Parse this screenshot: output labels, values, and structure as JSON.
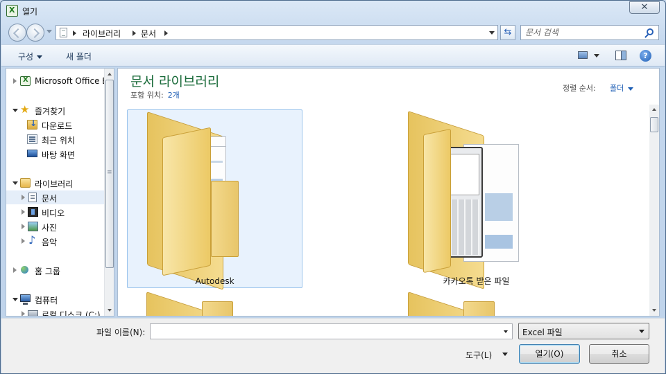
{
  "window": {
    "title": "열기",
    "close_glyph": "✕"
  },
  "address_bar": {
    "crumbs": [
      "라이브러리",
      "문서"
    ]
  },
  "search": {
    "placeholder": "문서 검색"
  },
  "toolbar": {
    "organize": "구성",
    "new_folder": "새 폴더",
    "help_glyph": "?"
  },
  "nav": {
    "items": [
      {
        "label": "Microsoft Office Excel",
        "icon": "excel-icon"
      },
      {
        "label": "즐겨찾기",
        "icon": "star-icon"
      },
      {
        "label": "다운로드",
        "icon": "downloads-folder-icon"
      },
      {
        "label": "최근 위치",
        "icon": "recent-places-icon"
      },
      {
        "label": "바탕 화면",
        "icon": "desktop-icon"
      },
      {
        "label": "라이브러리",
        "icon": "library-icon"
      },
      {
        "label": "문서",
        "icon": "documents-icon"
      },
      {
        "label": "비디오",
        "icon": "video-icon"
      },
      {
        "label": "사진",
        "icon": "pictures-icon"
      },
      {
        "label": "음악",
        "icon": "music-icon"
      },
      {
        "label": "홈 그룹",
        "icon": "homegroup-icon"
      },
      {
        "label": "컴퓨터",
        "icon": "computer-icon"
      },
      {
        "label": "로컬 디스크 (C:)",
        "icon": "disk-icon"
      }
    ]
  },
  "content": {
    "library_title": "문서 라이브러리",
    "includes_label": "포함 위치:",
    "includes_count": "2개",
    "sort_label": "정렬 순서:",
    "sort_value": "폴더",
    "folders": [
      {
        "name": "Autodesk",
        "icon": "folder-icon"
      },
      {
        "name": "카카오톡 받은 파일",
        "icon": "folder-icon"
      }
    ]
  },
  "bottom": {
    "filename_label": "파일 이름(N):",
    "filename_value": "",
    "filetype_value": "Excel 파일",
    "tools_label": "도구(L)",
    "open_button": "열기(O)",
    "cancel_button": "취소"
  }
}
